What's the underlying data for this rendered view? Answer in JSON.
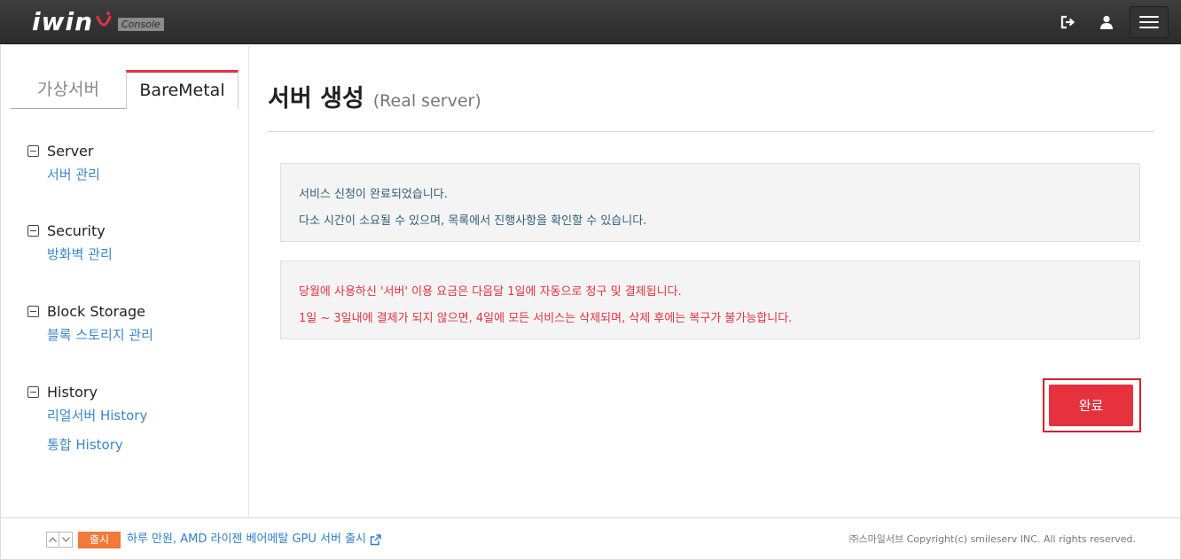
{
  "header": {
    "logo_text": "iwin",
    "console_label": "Console",
    "icons": [
      "logout-icon",
      "user-icon",
      "menu-icon"
    ]
  },
  "sidebar": {
    "tabs": [
      {
        "label": "가상서버",
        "active": false
      },
      {
        "label": "BareMetal",
        "active": true
      }
    ],
    "groups": [
      {
        "title": "Server",
        "links": [
          "서버 관리"
        ]
      },
      {
        "title": "Security",
        "links": [
          "방화벽 관리"
        ]
      },
      {
        "title": "Block Storage",
        "links": [
          "블록 스토리지 관리"
        ]
      },
      {
        "title": "History",
        "links": [
          "리얼서버 History",
          "통합 History"
        ]
      }
    ]
  },
  "main": {
    "title": "서버 생성",
    "subtitle": "(Real server)",
    "info_notice": [
      "서비스 신청이 완료되었습니다.",
      "다소 시간이 소요될 수 있으며, 목록에서 진행사항을 확인할 수 있습니다."
    ],
    "warning_notice": [
      "당월에 사용하신 '서버' 이용 요금은 다음달 1일에 자동으로 청구 및 결제됩니다.",
      "1일 ~ 3일내에 결제가 되지 않으면, 4일에 모든 서비스는 삭제되며, 삭제 후에는 복구가 불가능합니다."
    ],
    "done_label": "완료"
  },
  "footer": {
    "badge": "출시",
    "news": "하루 만원, AMD 라이젠 베어메탈 GPU 서버 출시",
    "copyright": "㈜스마일서브 Copyright(c) smileserv INC. All rights reserved."
  },
  "colors": {
    "accent": "#e5323e",
    "link": "#3a86c8",
    "badge": "#f07a3a",
    "info_text": "#2e5f78"
  }
}
